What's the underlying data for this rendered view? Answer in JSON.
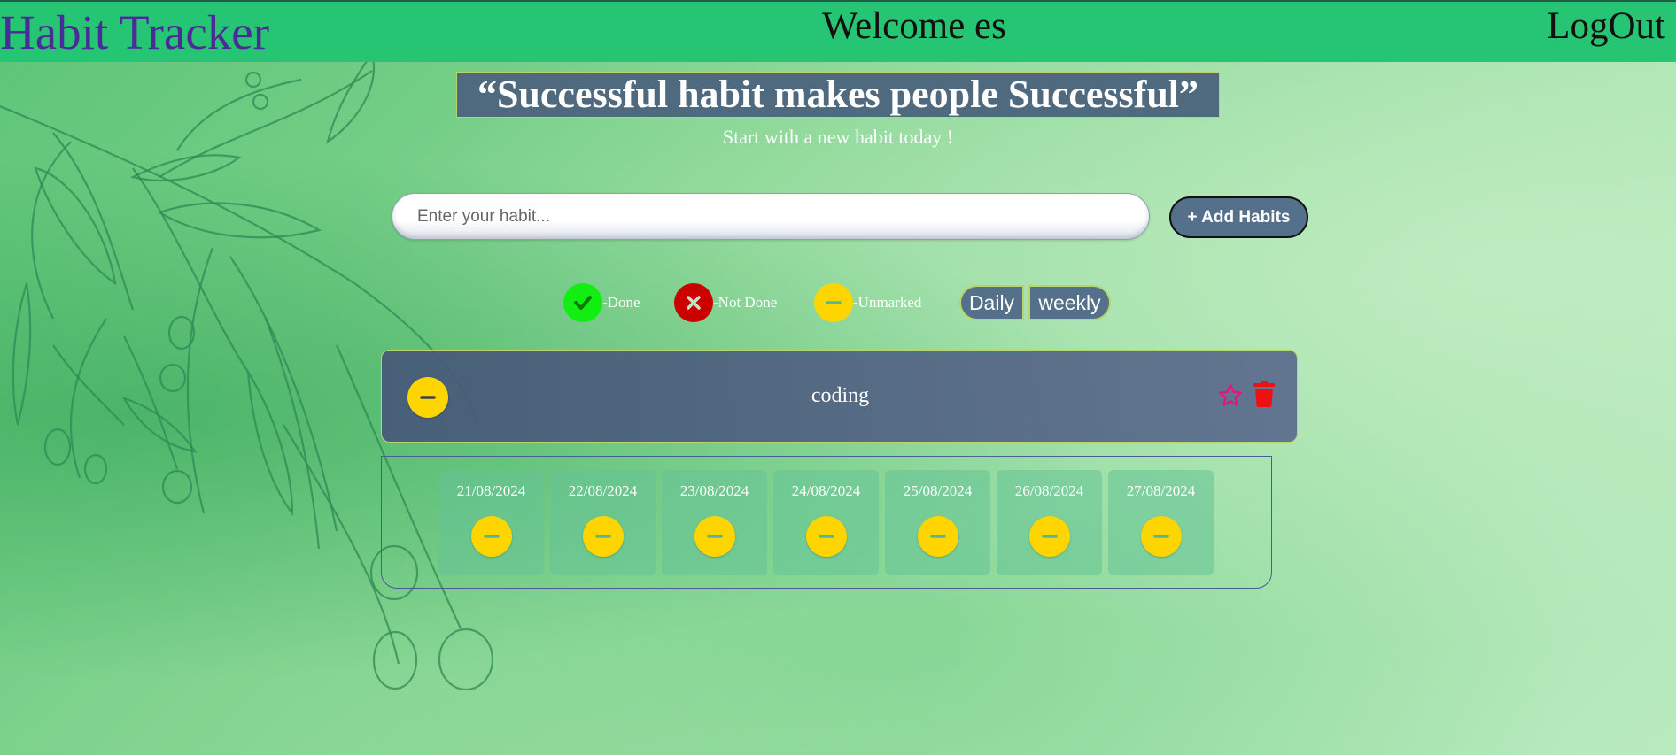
{
  "header": {
    "brand": "Habit Tracker",
    "welcome": "Welcome es",
    "logout_label": "LogOut"
  },
  "hero": {
    "quote": "“Successful habit makes people Successful”",
    "subtitle": "Start with a new habit today !"
  },
  "habit_form": {
    "placeholder": "Enter your habit...",
    "value": "",
    "add_label": "+ Add Habits"
  },
  "legend": {
    "done": {
      "label": "-Done",
      "color": "#12ee12",
      "icon": "check-icon"
    },
    "not_done": {
      "label": "-Not Done",
      "color": "#cc0000",
      "icon": "x-icon"
    },
    "unmarked": {
      "label": "-Unmarked",
      "color": "#ffd500",
      "icon": "minus-icon"
    }
  },
  "view_toggle": {
    "daily_label": "Daily",
    "weekly_label": "weekly"
  },
  "habits": [
    {
      "name": "coding",
      "status": "unmarked",
      "favorite_icon": "star-outline-icon",
      "delete_icon": "trash-icon",
      "days": [
        {
          "date": "21/08/2024",
          "status": "unmarked"
        },
        {
          "date": "22/08/2024",
          "status": "unmarked"
        },
        {
          "date": "23/08/2024",
          "status": "unmarked"
        },
        {
          "date": "24/08/2024",
          "status": "unmarked"
        },
        {
          "date": "25/08/2024",
          "status": "unmarked"
        },
        {
          "date": "26/08/2024",
          "status": "unmarked"
        },
        {
          "date": "27/08/2024",
          "status": "unmarked"
        }
      ]
    }
  ],
  "colors": {
    "header_bg": "#26c573",
    "brand_text": "#4b2a9a",
    "accent_button": "#55708a",
    "star": "#e0187a",
    "trash": "#ee1111"
  }
}
